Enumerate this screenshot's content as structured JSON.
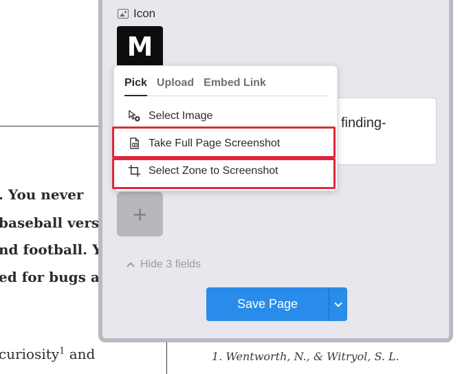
{
  "article": {
    "lines": [
      {
        "text": ". You never"
      },
      {
        "text": "baseball versus"
      },
      {
        "text": "nd football. Yo"
      },
      {
        "text": "ed for bugs and"
      }
    ],
    "curiosity_text": "curiosity",
    "footnote_marker": "1",
    "curiosity_after": " and",
    "footnote": "1. Wentworth, N., & Witryol, S. L."
  },
  "panel": {
    "icon_field_label": "Icon",
    "logo_letter": "M",
    "text_field_value": "finding-",
    "add_tile_symbol": "+",
    "hide_fields_label": "Hide 3 fields",
    "save_label": "Save Page"
  },
  "popover": {
    "tabs": [
      {
        "label": "Pick",
        "active": true
      },
      {
        "label": "Upload",
        "active": false
      },
      {
        "label": "Embed Link",
        "active": false
      }
    ],
    "items": [
      {
        "label": "Select Image",
        "icon": "cursor-plus-icon"
      },
      {
        "label": "Take Full Page Screenshot",
        "icon": "page-screenshot-icon"
      },
      {
        "label": "Select Zone to Screenshot",
        "icon": "crop-icon"
      }
    ]
  },
  "colors": {
    "accent": "#2a8cea",
    "highlight": "#e0273a",
    "panel_bg": "#e7e7ed"
  }
}
